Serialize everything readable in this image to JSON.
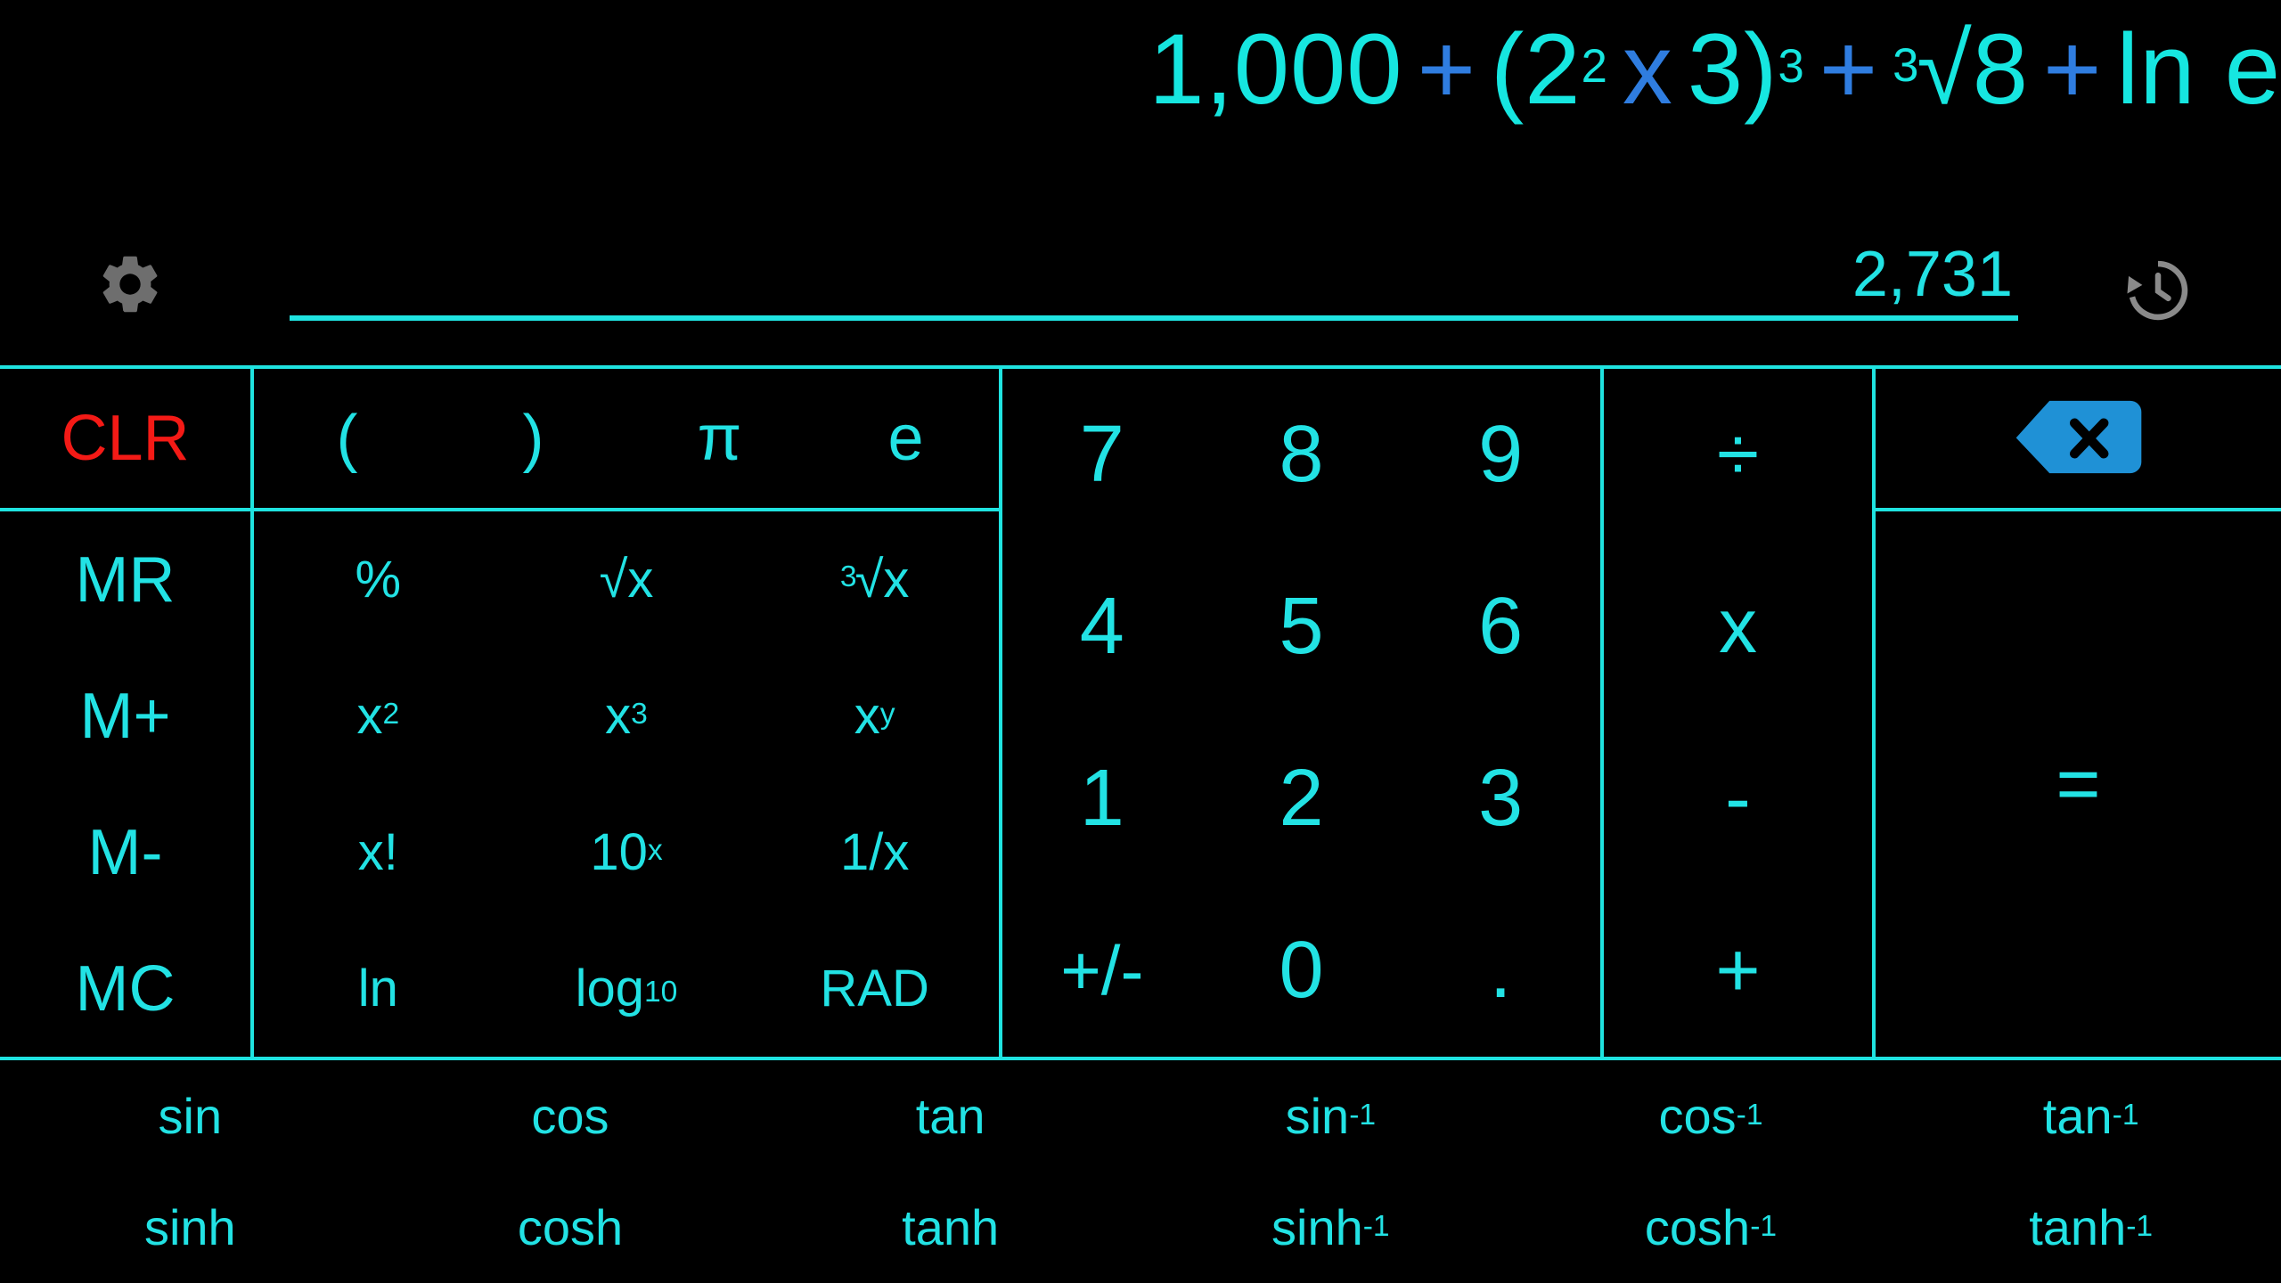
{
  "display": {
    "expression_text": "1,000 + (2² x 3)³ + ³√8 + ln e",
    "expression_tokens": [
      {
        "type": "number",
        "text": "1,000"
      },
      {
        "type": "operator",
        "text": "+"
      },
      {
        "type": "paren",
        "text": "("
      },
      {
        "type": "number",
        "text": "2",
        "sup": "2"
      },
      {
        "type": "operator",
        "text": "x"
      },
      {
        "type": "number",
        "text": "3"
      },
      {
        "type": "paren",
        "text": ")",
        "sup": "3"
      },
      {
        "type": "operator",
        "text": "+"
      },
      {
        "type": "radical",
        "presup": "3",
        "text": "√8"
      },
      {
        "type": "operator",
        "text": "+"
      },
      {
        "type": "function",
        "text": "ln e"
      }
    ],
    "result": "2,731",
    "settings_icon": "gear-icon",
    "history_icon": "history-icon"
  },
  "memory": {
    "clear_label": "CLR",
    "keys": [
      "MR",
      "M+",
      "M-",
      "MC"
    ]
  },
  "scientific": {
    "paren_open": "(",
    "paren_close": ")",
    "pi": "π",
    "e": "e",
    "grid": [
      [
        {
          "text": "%"
        },
        {
          "text": "√x"
        },
        {
          "presup": "3",
          "text": "√x"
        }
      ],
      [
        {
          "text": "x",
          "sup": "2"
        },
        {
          "text": "x",
          "sup": "3"
        },
        {
          "text": "x",
          "sup": "y"
        }
      ],
      [
        {
          "text": "x!"
        },
        {
          "text": "10",
          "sup": "x"
        },
        {
          "text": "1/x"
        }
      ],
      [
        {
          "text": "ln"
        },
        {
          "text": "log",
          "sub": "10"
        },
        {
          "text": "RAD"
        }
      ]
    ]
  },
  "numpad": {
    "keys": [
      "7",
      "8",
      "9",
      "4",
      "5",
      "6",
      "1",
      "2",
      "3",
      "+/-",
      "0",
      "."
    ]
  },
  "operators": {
    "divide": "÷",
    "multiply": "x",
    "subtract": "-",
    "add": "+"
  },
  "actions": {
    "backspace_icon": "backspace-icon",
    "equals": "="
  },
  "trig": {
    "row1": [
      {
        "text": "sin"
      },
      {
        "text": "cos"
      },
      {
        "text": "tan"
      },
      {
        "text": "sin",
        "sup": "-1"
      },
      {
        "text": "cos",
        "sup": "-1"
      },
      {
        "text": "tan",
        "sup": "-1"
      }
    ],
    "row2": [
      {
        "text": "sinh"
      },
      {
        "text": "cosh"
      },
      {
        "text": "tanh"
      },
      {
        "text": "sinh",
        "sup": "-1"
      },
      {
        "text": "cosh",
        "sup": "-1"
      },
      {
        "text": "tanh",
        "sup": "-1"
      }
    ]
  },
  "colors": {
    "background": "#000000",
    "accent_cyan": "#22e2e4",
    "operator_blue": "#2f7de0",
    "clear_red": "#f41a16",
    "icon_gray": "#6e6e6e",
    "backspace_blue": "#1f91d6"
  }
}
